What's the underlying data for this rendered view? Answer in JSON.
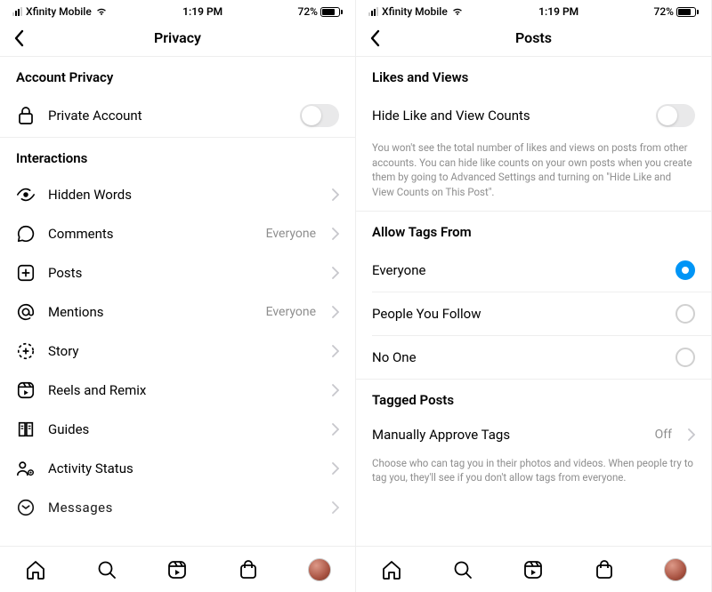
{
  "left": {
    "status": {
      "carrier": "Xfinity Mobile",
      "time": "1:19 PM",
      "battery_pct": "72%"
    },
    "nav_title": "Privacy",
    "section_account_privacy": "Account Privacy",
    "private_account_label": "Private Account",
    "section_interactions": "Interactions",
    "interactions": {
      "hidden_words": "Hidden Words",
      "comments": "Comments",
      "comments_value": "Everyone",
      "posts": "Posts",
      "mentions": "Mentions",
      "mentions_value": "Everyone",
      "story": "Story",
      "reels": "Reels and Remix",
      "guides": "Guides",
      "activity": "Activity Status",
      "messages": "Messages"
    }
  },
  "right": {
    "status": {
      "carrier": "Xfinity Mobile",
      "time": "1:19 PM",
      "battery_pct": "72%"
    },
    "nav_title": "Posts",
    "section_likes_views": "Likes and Views",
    "hide_counts_label": "Hide Like and View Counts",
    "hide_counts_help": "You won't see the total number of likes and views on posts from other accounts. You can hide like counts on your own posts when you create them by going to Advanced Settings and turning on \"Hide Like and View Counts on This Post\".",
    "section_allow_tags": "Allow Tags From",
    "tags_options": {
      "everyone": "Everyone",
      "people_you_follow": "People You Follow",
      "no_one": "No One"
    },
    "section_tagged_posts": "Tagged Posts",
    "manually_approve_label": "Manually Approve Tags",
    "manually_approve_value": "Off",
    "tagged_help": "Choose who can tag you in their photos and videos. When people try to tag you, they'll see if you don't allow tags from everyone."
  }
}
